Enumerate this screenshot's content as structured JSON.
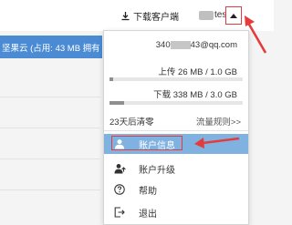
{
  "header": {
    "download_client_label": "下载客户端",
    "username_suffix": "test"
  },
  "background": {
    "storage_bar_text": "坚果云 (占用: 43 MB   拥有"
  },
  "dropdown": {
    "email_prefix": "340",
    "email_suffix": "43@qq.com",
    "upload_text": "上传 26 MB / 1.0 GB",
    "upload_fraction": 0.025,
    "download_text": "下载 338 MB / 3.0 GB",
    "download_fraction": 0.11,
    "reset_text": "23天后清零",
    "rules_link": "流量规则>>",
    "items": [
      {
        "label": "账户信息",
        "icon": "user-icon",
        "active": true
      },
      {
        "label": "账户升级",
        "icon": "user-upgrade-icon",
        "active": false
      },
      {
        "label": "帮助",
        "icon": "help-icon",
        "active": false
      },
      {
        "label": "退出",
        "icon": "logout-icon",
        "active": false
      }
    ]
  },
  "colors": {
    "accent_blue": "#4a8bd4",
    "active_item": "#7fb2e0",
    "annotation_red": "#e43c3c"
  }
}
